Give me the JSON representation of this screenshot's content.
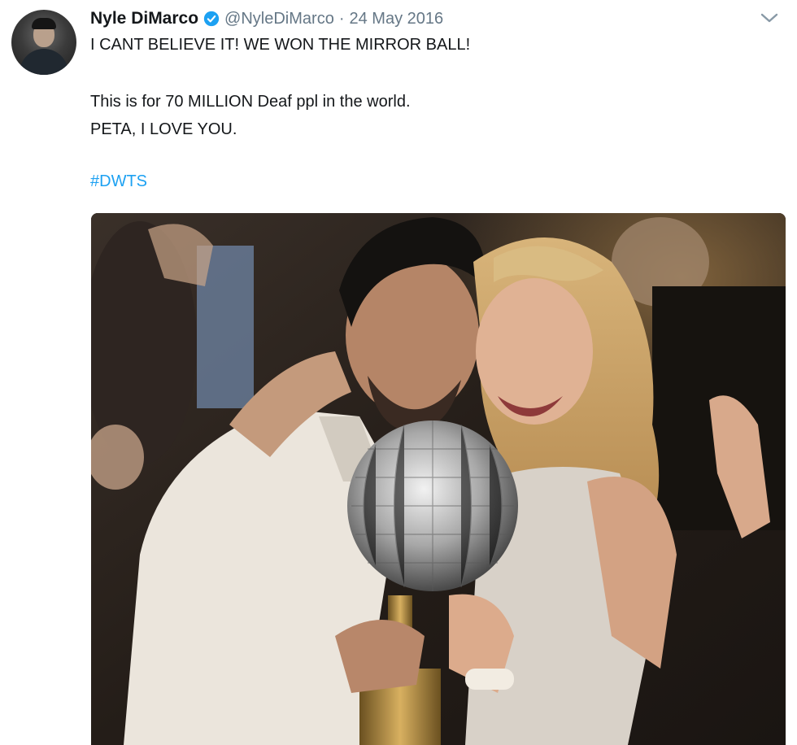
{
  "tweet": {
    "display_name": "Nyle DiMarco",
    "handle": "@NyleDiMarco",
    "separator": "·",
    "date": "24 May 2016",
    "text_line_1": "I CANT BELIEVE IT! WE WON THE MIRROR BALL!",
    "text_line_2": "This is for 70 MILLION Deaf ppl in the world.",
    "text_line_3": "PETA, I LOVE YOU.",
    "hashtag": "#DWTS"
  },
  "icons": {
    "verified": "verified-badge-icon",
    "menu": "chevron-down-icon"
  },
  "colors": {
    "text": "#14171a",
    "secondary": "#657786",
    "link": "#1da1f2",
    "verified": "#1da1f2"
  }
}
